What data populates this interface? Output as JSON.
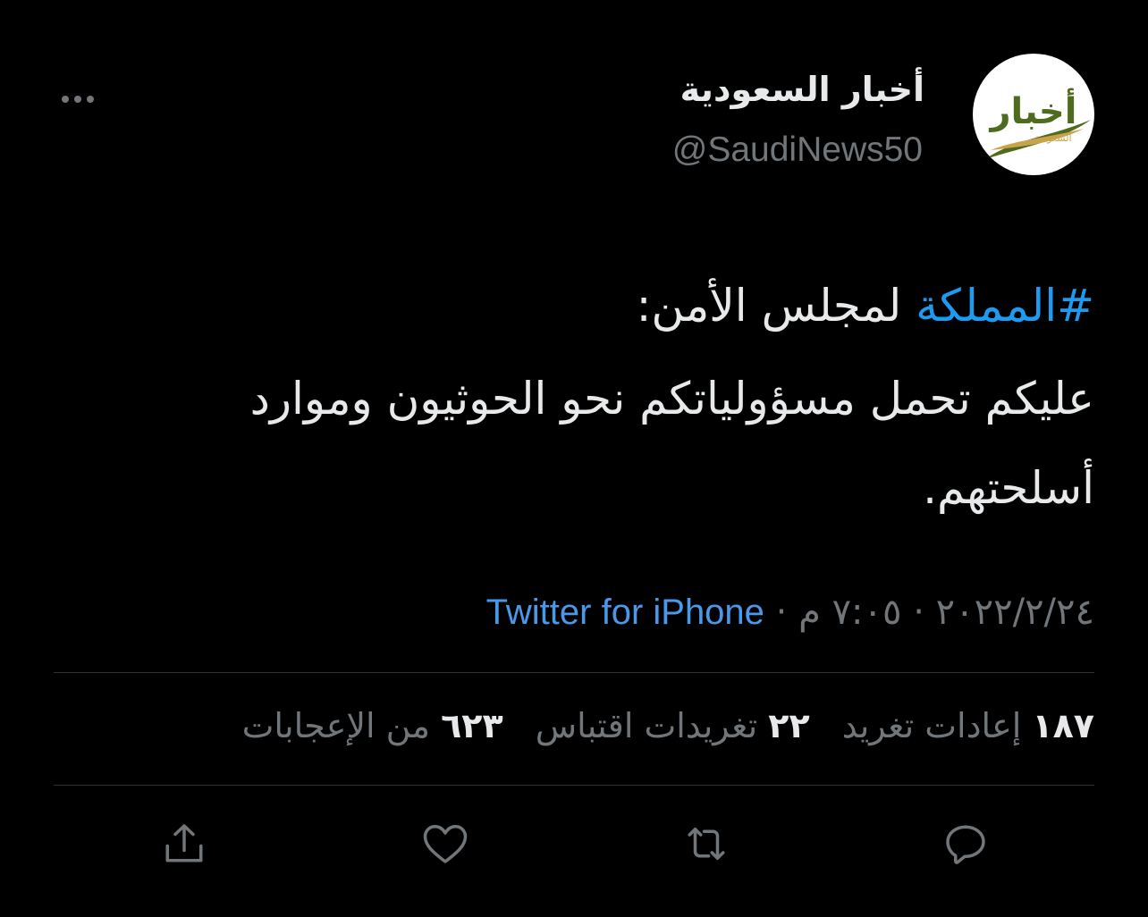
{
  "tweet": {
    "author": {
      "display_name": "أخبار السعودية",
      "handle": "@SaudiNews50",
      "avatar_text": "أخبار",
      "avatar_subtext": "السعودية"
    },
    "hashtag": "#المملكة",
    "text_line1_rest": " لمجلس الأمن:",
    "text_line2": "عليكم تحمل مسؤولياتكم نحو الحوثيون وموارد أسلحتهم.",
    "date": "٢٠٢٢/٢/٢٤",
    "time": "٧:٠٥ م",
    "separator": "·",
    "source": "Twitter for iPhone"
  },
  "stats": {
    "retweets_count": "١٨٧",
    "retweets_label": "إعادات تغريد",
    "quotes_count": "٢٢",
    "quotes_label": "تغريدات اقتباس",
    "likes_count": "٦٢٣",
    "likes_label": "من الإعجابات"
  },
  "colors": {
    "background": "#000000",
    "text_primary": "#e7e9ea",
    "text_secondary": "#71767b",
    "accent": "#1d9bf0",
    "divider": "#2f3336",
    "logo_green": "#4e6b1e",
    "logo_gold": "#c9a34a"
  },
  "icons": {
    "more": "more-horizontal-icon",
    "reply": "reply-icon",
    "retweet": "retweet-icon",
    "like": "heart-icon",
    "share": "share-icon"
  }
}
